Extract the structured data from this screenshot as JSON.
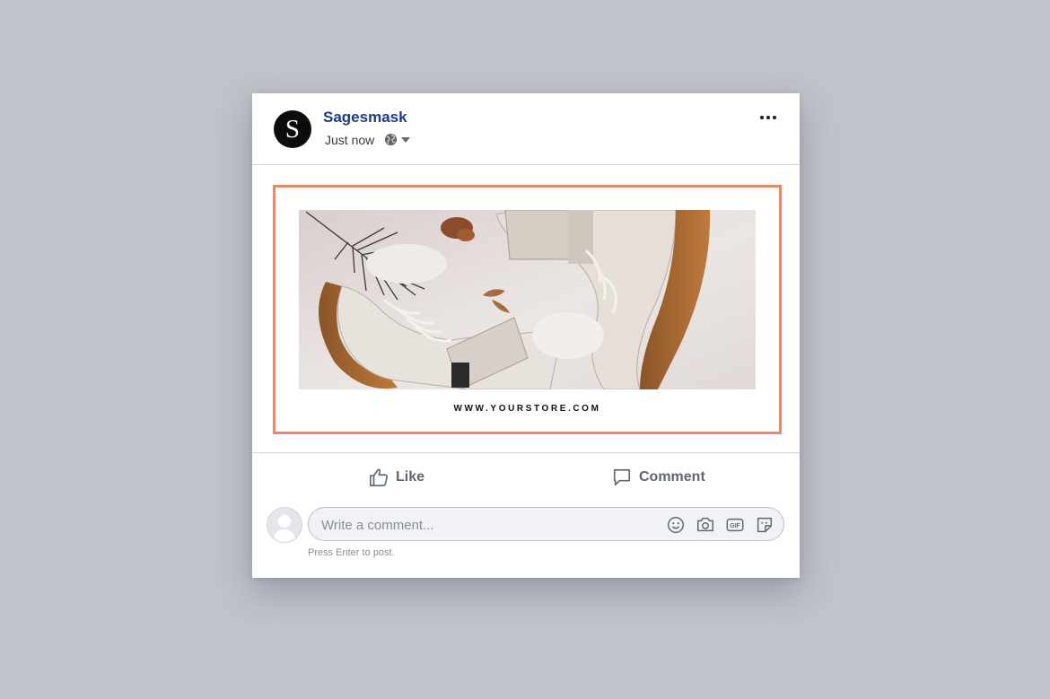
{
  "post": {
    "page_name": "Sagesmask",
    "avatar_letter": "S",
    "timestamp": "Just now",
    "privacy_icon": "globe-icon",
    "more_icon": "more-dots-icon"
  },
  "ad": {
    "store_url": "WWW.YOURSTORE.COM",
    "frame_color": "#e48a6b"
  },
  "actions": {
    "like_label": "Like",
    "comment_label": "Comment"
  },
  "comment": {
    "placeholder": "Write a comment...",
    "hint": "Press Enter to post.",
    "tools": [
      "emoji-icon",
      "camera-icon",
      "gif-icon",
      "sticker-icon"
    ]
  },
  "colors": {
    "background": "#c0c3ca",
    "name": "#1e3a8a",
    "action_text": "#606770"
  }
}
